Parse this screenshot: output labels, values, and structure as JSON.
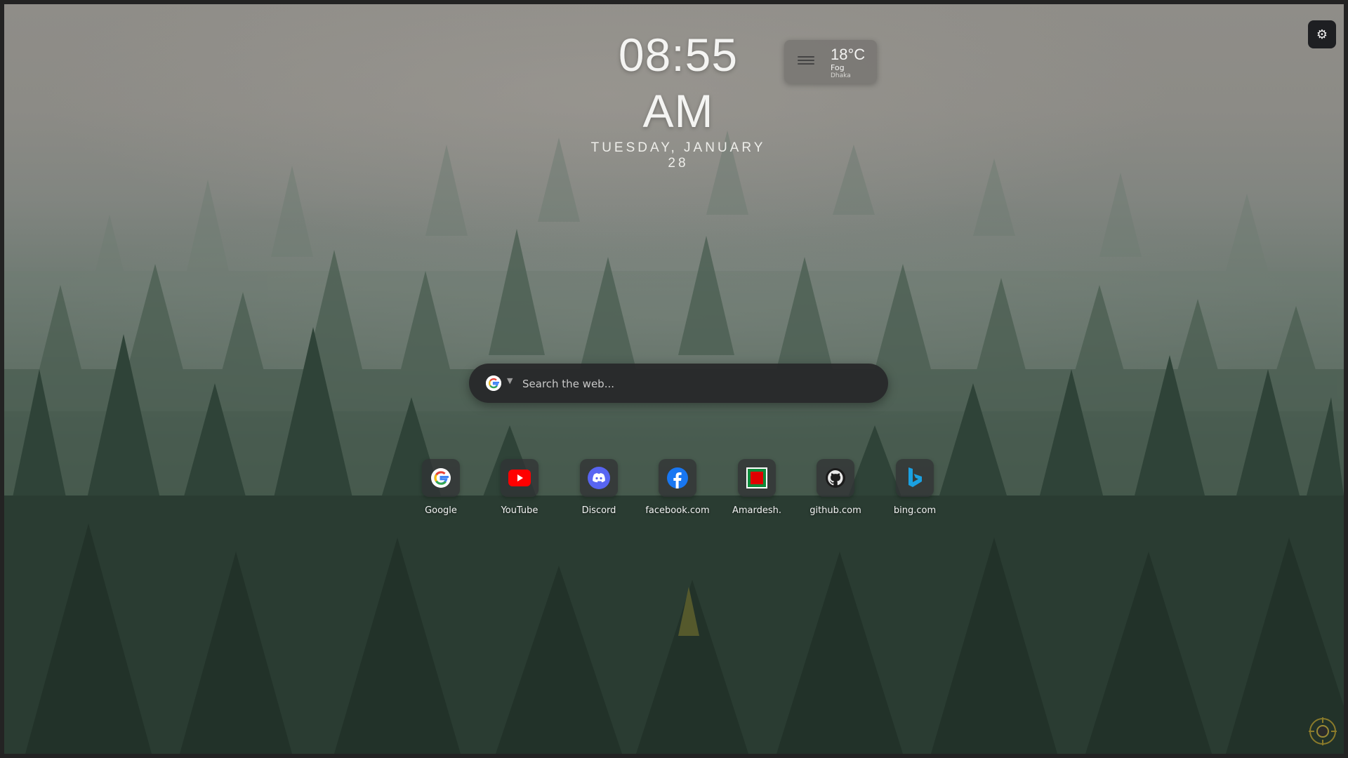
{
  "clock": {
    "time": "08:55 AM",
    "date": "TUESDAY, JANUARY 28"
  },
  "weather": {
    "temperature": "18°C",
    "condition": "Fog",
    "city": "Dhaka",
    "icon": "fog-icon"
  },
  "settings": {
    "icon": "gear-icon"
  },
  "search": {
    "placeholder": "Search the web...",
    "value": "",
    "engine_icon": "google-icon"
  },
  "shortcuts": [
    {
      "label": "Google",
      "icon": "google-icon"
    },
    {
      "label": "YouTube",
      "icon": "youtube-icon"
    },
    {
      "label": "Discord",
      "icon": "discord-icon"
    },
    {
      "label": "facebook.com",
      "icon": "facebook-icon"
    },
    {
      "label": "Amardesh.",
      "icon": "amardesh-icon"
    },
    {
      "label": "github.com",
      "icon": "github-icon"
    },
    {
      "label": "bing.com",
      "icon": "bing-icon"
    }
  ],
  "colors": {
    "accent_youtube": "#ff0000",
    "accent_discord": "#5865f2",
    "accent_facebook": "#1877f2",
    "accent_amardesh": "#e00000",
    "accent_bing": "#1aa1e2"
  }
}
